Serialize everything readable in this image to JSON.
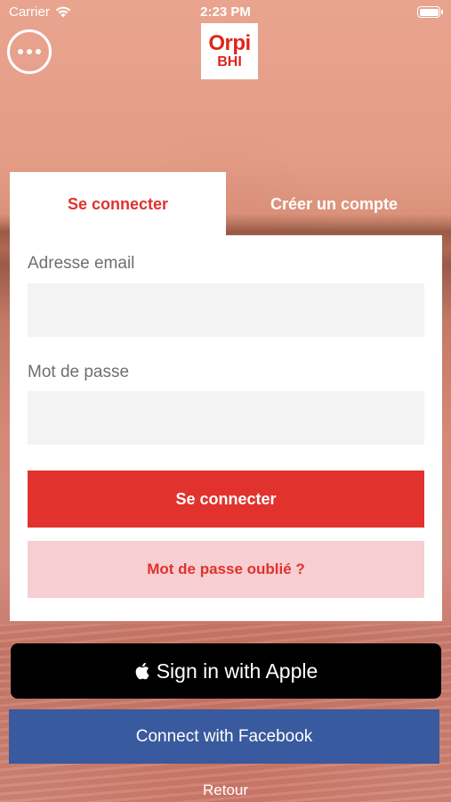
{
  "status_bar": {
    "carrier": "Carrier",
    "time": "2:23 PM",
    "battery_level": 1.0
  },
  "header": {
    "logo_line1": "Orpi",
    "logo_line2": "BHI",
    "brand_color": "#e2231a"
  },
  "tabs": {
    "login": "Se connecter",
    "register": "Créer un compte"
  },
  "form": {
    "email_label": "Adresse email",
    "email_value": "",
    "password_label": "Mot de passe",
    "password_value": "",
    "submit_label": "Se connecter",
    "forgot_label": "Mot de passe oublié ?"
  },
  "social": {
    "apple_label": "Sign in with Apple",
    "facebook_label": "Connect with Facebook"
  },
  "footer": {
    "back_label": "Retour"
  },
  "icons": {
    "more": "more-icon",
    "wifi": "wifi-icon",
    "battery": "battery-icon",
    "apple": "apple-icon"
  },
  "colors": {
    "accent": "#e2322d",
    "secondary_button": "#f7ced1",
    "facebook": "#395a9e",
    "apple": "#000000"
  }
}
